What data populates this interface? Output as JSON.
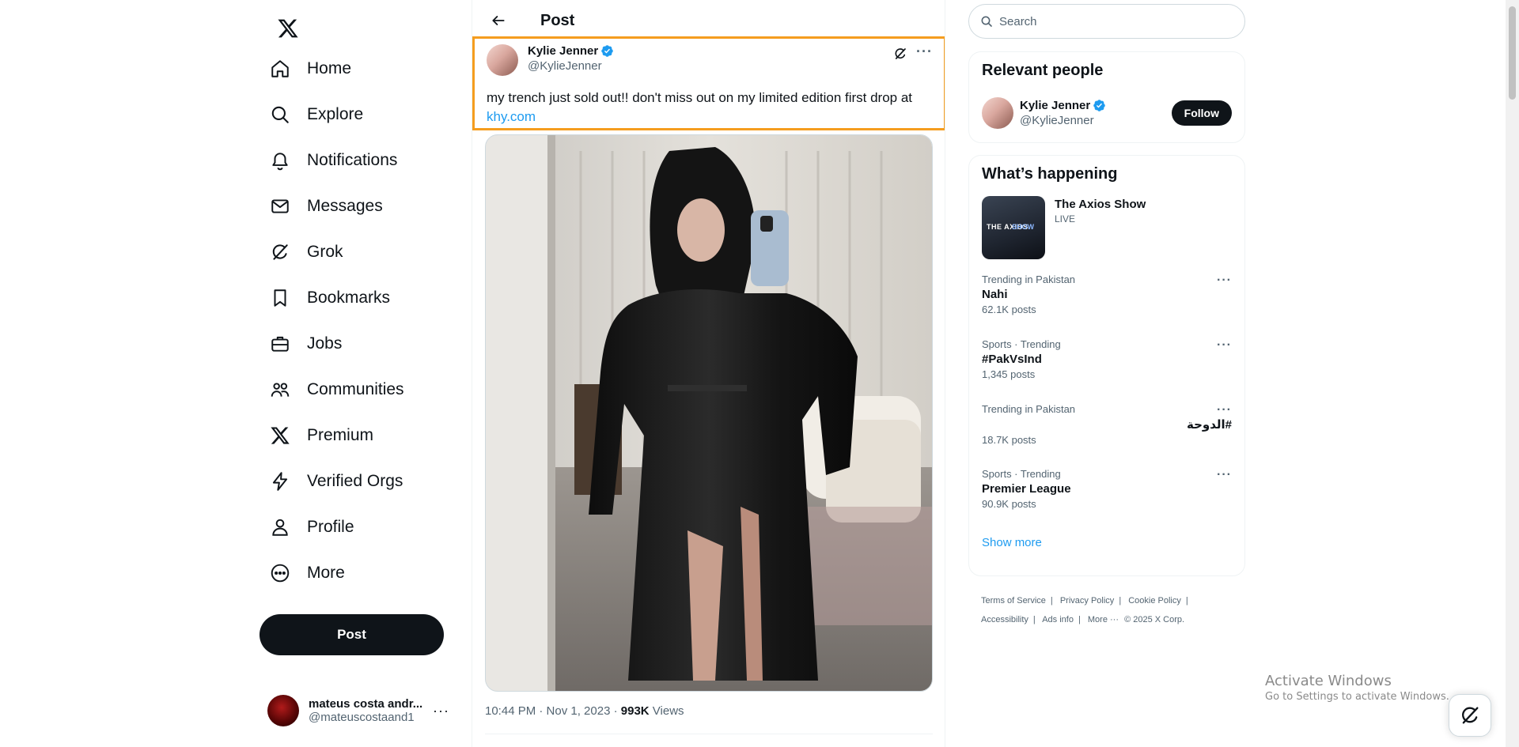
{
  "nav": {
    "items": [
      {
        "label": "Home",
        "icon": "home-icon"
      },
      {
        "label": "Explore",
        "icon": "search-icon"
      },
      {
        "label": "Notifications",
        "icon": "bell-icon"
      },
      {
        "label": "Messages",
        "icon": "envelope-icon"
      },
      {
        "label": "Grok",
        "icon": "grok-icon"
      },
      {
        "label": "Bookmarks",
        "icon": "bookmark-icon"
      },
      {
        "label": "Jobs",
        "icon": "briefcase-icon"
      },
      {
        "label": "Communities",
        "icon": "people-icon"
      },
      {
        "label": "Premium",
        "icon": "x-logo-icon"
      },
      {
        "label": "Verified Orgs",
        "icon": "lightning-icon"
      },
      {
        "label": "Profile",
        "icon": "person-icon"
      },
      {
        "label": "More",
        "icon": "more-circle-icon"
      }
    ],
    "post_button": "Post",
    "account": {
      "name": "mateus costa andr...",
      "handle": "@mateuscostaand1"
    }
  },
  "main": {
    "header_title": "Post",
    "post": {
      "author_name": "Kylie Jenner",
      "author_handle": "@KylieJenner",
      "text": "my trench just sold out!! don't miss out on my limited edition first drop at",
      "link": "khy.com",
      "timestamp": "10:44 PM · Nov 1, 2023 · ",
      "views_count": "993K",
      "views_label": " Views"
    }
  },
  "sidebar": {
    "search_placeholder": "Search",
    "relevant_people": {
      "title": "Relevant people",
      "name": "Kylie Jenner",
      "handle": "@KylieJenner",
      "follow_label": "Follow"
    },
    "whats_happening": {
      "title": "What’s happening",
      "live": {
        "title": "The Axios Show",
        "status": "LIVE",
        "thumb_text_1": "THE AXIOS",
        "thumb_text_2": "SHOW"
      },
      "trends": [
        {
          "context": "Trending in Pakistan",
          "name": "Nahi",
          "count": "62.1K posts"
        },
        {
          "context": "Sports · Trending",
          "name": "#PakVsInd",
          "count": "1,345 posts"
        },
        {
          "context": "Trending in Pakistan",
          "name": "#الدوحة",
          "count": "18.7K posts"
        },
        {
          "context": "Sports · Trending",
          "name": "Premier League",
          "count": "90.9K posts"
        }
      ],
      "show_more": "Show more"
    },
    "footer": {
      "links": [
        "Terms of Service",
        "Privacy Policy",
        "Cookie Policy",
        "Accessibility",
        "Ads info",
        "More ···"
      ],
      "copyright": "© 2025 X Corp."
    }
  },
  "os": {
    "watermark_title": "Activate Windows",
    "watermark_subtitle": "Go to Settings to activate Windows."
  },
  "colors": {
    "accent": "#1d9bf0",
    "highlight_border": "#f59d1f",
    "text_primary": "#0f1419",
    "text_secondary": "#536471"
  }
}
